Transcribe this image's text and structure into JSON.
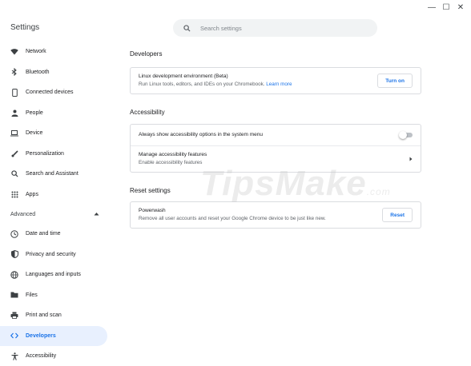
{
  "window": {
    "controls": [
      {
        "name": "minimize",
        "glyph": "—"
      },
      {
        "name": "maximize",
        "glyph": "☐"
      },
      {
        "name": "close",
        "glyph": "✕"
      }
    ]
  },
  "header": {
    "title": "Settings",
    "search": {
      "placeholder": "Search settings",
      "value": ""
    }
  },
  "sidebar": {
    "items": [
      {
        "label": "Network",
        "icon": "wifi-icon"
      },
      {
        "label": "Bluetooth",
        "icon": "bluetooth-icon"
      },
      {
        "label": "Connected devices",
        "icon": "phone-icon"
      },
      {
        "label": "People",
        "icon": "person-icon"
      },
      {
        "label": "Device",
        "icon": "laptop-icon"
      },
      {
        "label": "Personalization",
        "icon": "brush-icon"
      },
      {
        "label": "Search and Assistant",
        "icon": "search-icon"
      },
      {
        "label": "Apps",
        "icon": "apps-grid-icon"
      }
    ],
    "advanced_label": "Advanced",
    "advanced_items": [
      {
        "label": "Date and time",
        "icon": "clock-icon"
      },
      {
        "label": "Privacy and security",
        "icon": "shield-icon"
      },
      {
        "label": "Languages and inputs",
        "icon": "globe-icon"
      },
      {
        "label": "Files",
        "icon": "folder-icon"
      },
      {
        "label": "Print and scan",
        "icon": "printer-icon"
      },
      {
        "label": "Developers",
        "icon": "code-icon",
        "active": true
      },
      {
        "label": "Accessibility",
        "icon": "accessibility-icon"
      }
    ]
  },
  "main": {
    "developers": {
      "title": "Developers",
      "linux": {
        "title": "Linux development environment (Beta)",
        "subtitle": "Run Linux tools, editors, and IDEs on your Chromebook.",
        "link": "Learn more",
        "button": "Turn on"
      }
    },
    "accessibility": {
      "title": "Accessibility",
      "always_show": "Always show accessibility options in the system menu",
      "manage_title": "Manage accessibility features",
      "manage_sub": "Enable accessibility features"
    },
    "reset": {
      "title": "Reset settings",
      "powerwash_title": "Powerwash",
      "powerwash_sub": "Remove all user accounts and reset your Google Chrome device to be just like new.",
      "button": "Reset"
    }
  },
  "watermark": {
    "text": "TipsMake",
    "suffix": ".com"
  },
  "colors": {
    "accent": "#1a73e8",
    "active_bg": "#e8f0fe",
    "border": "#dadce0"
  }
}
